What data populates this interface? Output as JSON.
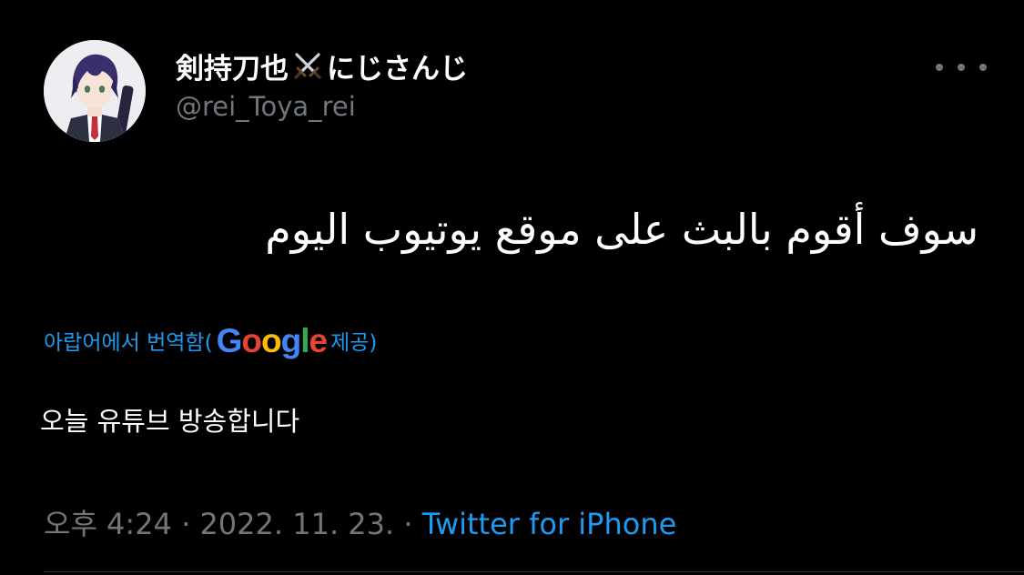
{
  "user": {
    "display_name_before": "剣持刀也",
    "display_name_emoji": "crossed-swords-icon",
    "display_name_after": "にじさんじ",
    "handle": "@rei_Toya_rei"
  },
  "menu": {
    "more_icon": "more-options-icon"
  },
  "tweet": {
    "text": "سوف أقوم بالبث على موقع يوتيوب اليوم",
    "translation_label_prefix": "아랍어에서 번역함(",
    "translation_provider": "Google",
    "translation_label_suffix": " 제공)",
    "translated_text": "오늘 유튜브 방송합니다"
  },
  "meta": {
    "time": "오후 4:24",
    "separator": " · ",
    "date": "2022. 11. 23.",
    "source": "Twitter for iPhone"
  },
  "colors": {
    "background": "#000000",
    "link": "#1d9bf0",
    "secondary": "#71767b",
    "google_blue": "#4285F4",
    "google_red": "#EA4335",
    "google_yellow": "#FBBC05",
    "google_green": "#34A853"
  }
}
